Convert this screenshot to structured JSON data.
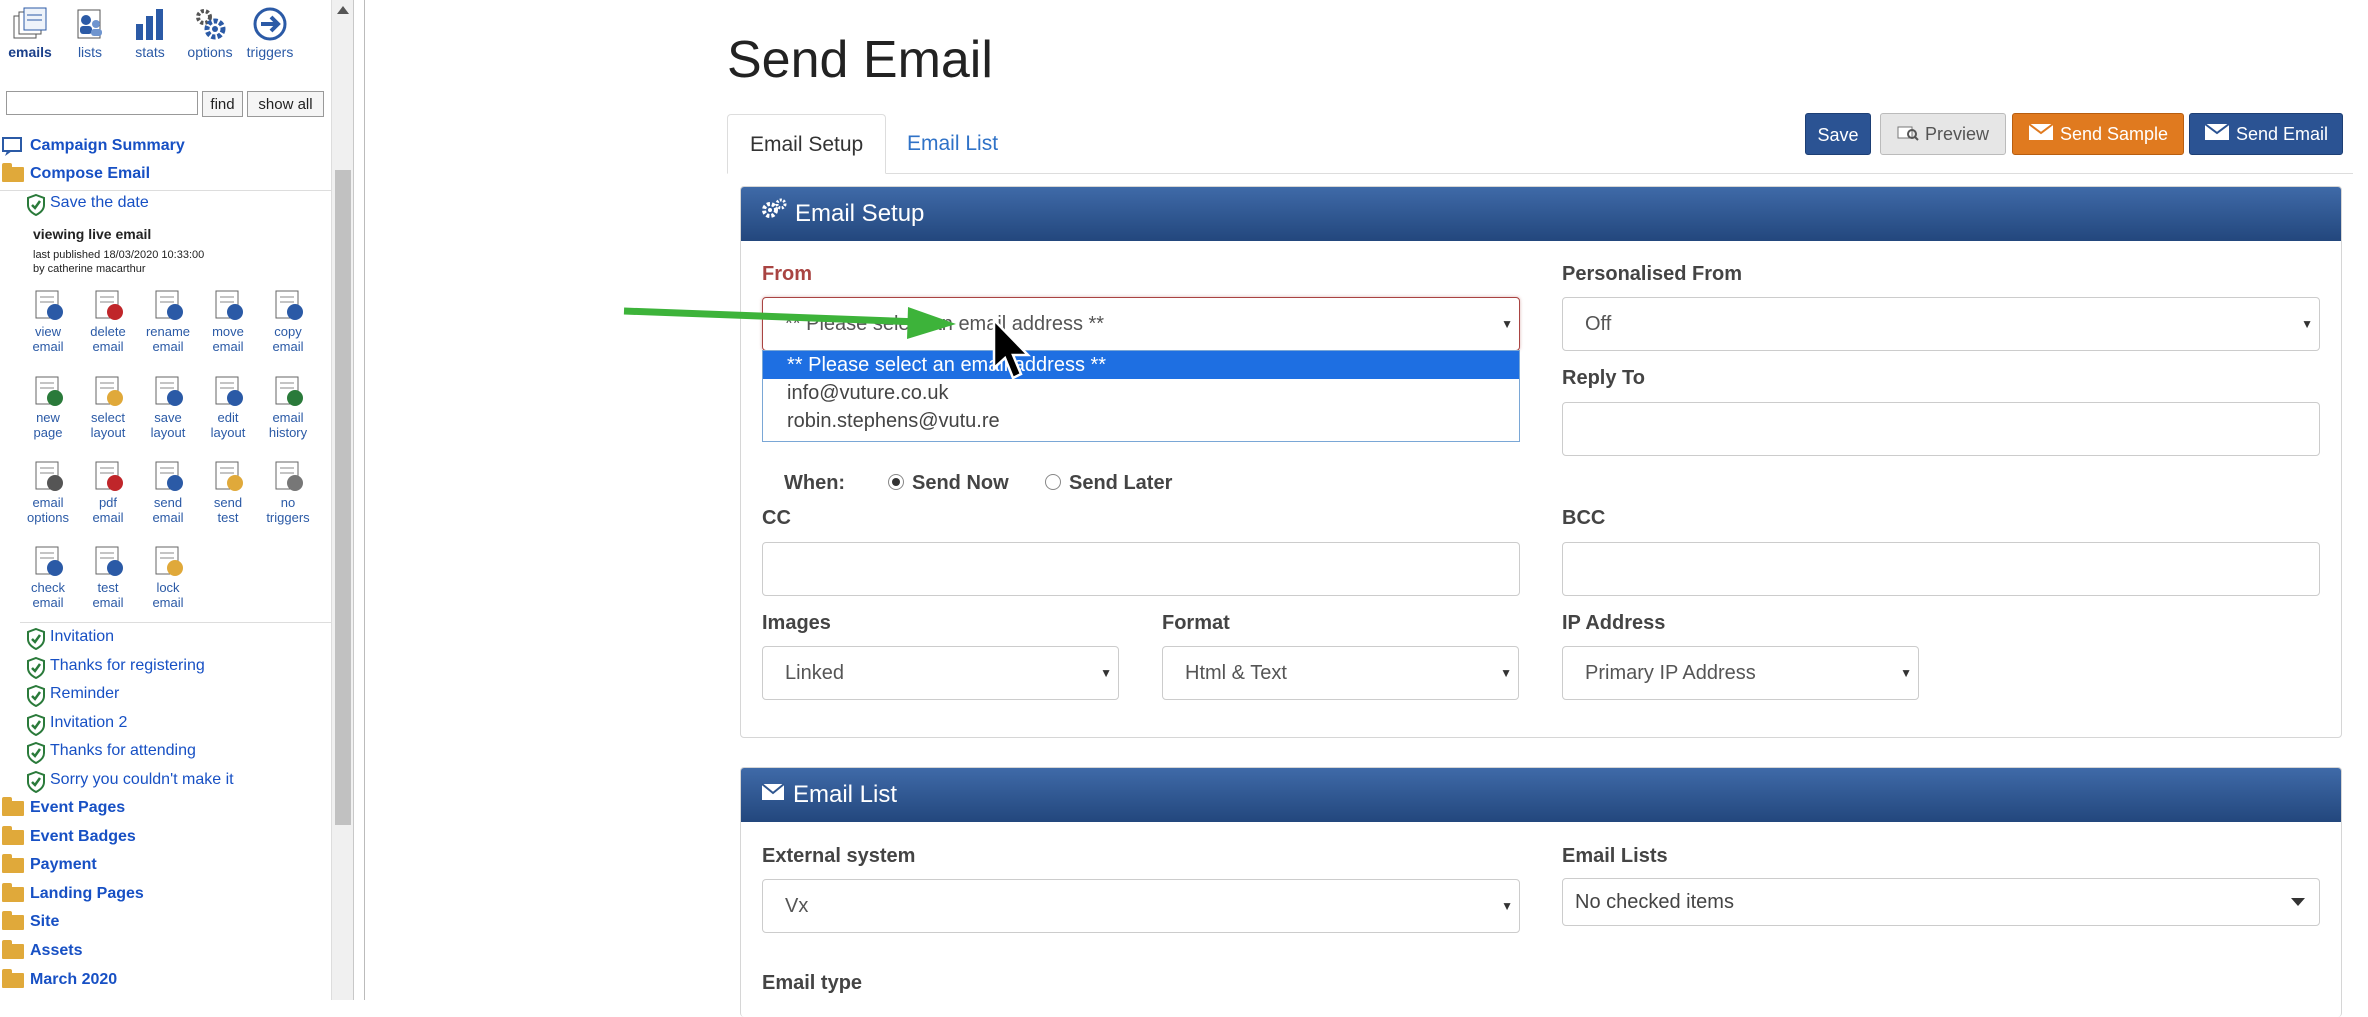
{
  "left": {
    "top_icons": [
      {
        "label": "emails",
        "icon": "emails-icon",
        "active": true
      },
      {
        "label": "lists",
        "icon": "lists-icon",
        "active": false
      },
      {
        "label": "stats",
        "icon": "stats-icon",
        "active": false
      },
      {
        "label": "options",
        "icon": "options-icon",
        "active": false
      },
      {
        "label": "triggers",
        "icon": "triggers-icon",
        "active": false
      }
    ],
    "search": {
      "value": "",
      "find_label": "find",
      "show_all_label": "show all"
    },
    "campaign_summary": "Campaign Summary",
    "compose_email": "Compose Email",
    "save_the_date": "Save the date",
    "viewing": "viewing  live  email",
    "published": "last published 18/03/2020 10:33:00",
    "published_by": "by catherine macarthur",
    "tools": [
      [
        "view",
        "email"
      ],
      [
        "delete",
        "email"
      ],
      [
        "rename",
        "email"
      ],
      [
        "move",
        "email"
      ],
      [
        "copy",
        "email"
      ],
      [
        "new",
        "page"
      ],
      [
        "select",
        "layout"
      ],
      [
        "save",
        "layout"
      ],
      [
        "edit",
        "layout"
      ],
      [
        "email",
        "history"
      ],
      [
        "email",
        "options"
      ],
      [
        "pdf",
        "email"
      ],
      [
        "send",
        "email"
      ],
      [
        "send",
        "test"
      ],
      [
        "no",
        "triggers"
      ],
      [
        "check",
        "email"
      ],
      [
        "test",
        "email"
      ],
      [
        "lock",
        "email"
      ]
    ],
    "emails": [
      "Invitation",
      "Thanks for registering",
      "Reminder",
      "Invitation 2",
      "Thanks for attending",
      "Sorry you couldn't make it"
    ],
    "folders": [
      "Event Pages",
      "Event Badges",
      "Payment",
      "Landing Pages",
      "Site",
      "Assets",
      "March 2020"
    ]
  },
  "main": {
    "title": "Send Email",
    "tabs": [
      "Email Setup",
      "Email List"
    ],
    "buttons": {
      "save": "Save",
      "preview": "Preview",
      "send_sample": "Send Sample",
      "send_email": "Send Email"
    },
    "setup": {
      "heading": "Email Setup",
      "from_label": "From",
      "from_value": "** Please select an email address **",
      "from_options": [
        "** Please select an email address **",
        "info@vuture.co.uk",
        "robin.stephens@vutu.re"
      ],
      "personalised_from_label": "Personalised From",
      "personalised_from_value": "Off",
      "reply_to_label": "Reply To",
      "reply_to_value": "",
      "when_label": "When:",
      "send_now": "Send Now",
      "send_later": "Send Later",
      "cc_label": "CC",
      "bcc_label": "BCC",
      "images_label": "Images",
      "images_value": "Linked",
      "format_label": "Format",
      "format_value": "Html & Text",
      "ip_label": "IP Address",
      "ip_value": "Primary IP Address"
    },
    "list": {
      "heading": "Email List",
      "external_label": "External system",
      "external_value": "Vx",
      "lists_label": "Email Lists",
      "lists_value": "No checked items",
      "type_label": "Email type"
    }
  },
  "colors": {
    "link": "#1750c4",
    "panel_head": "#2f568f",
    "save_btn": "#2b5393",
    "sample_btn": "#e07a1f",
    "error": "#a94442",
    "arrow": "#3db33a"
  }
}
